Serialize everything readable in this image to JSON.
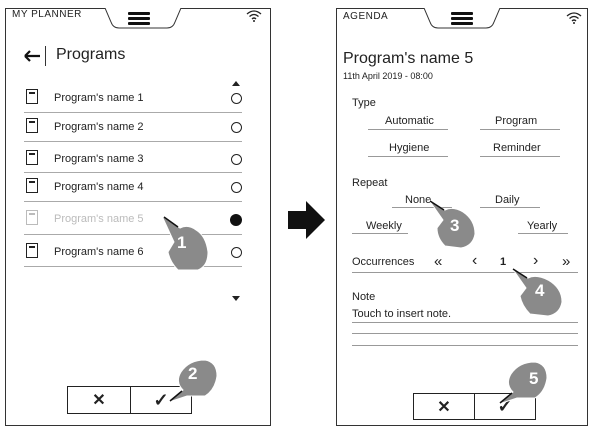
{
  "left_screen": {
    "app_title": "MY PLANNER",
    "back_icon": "arrow-left-icon",
    "page_title": "Programs",
    "items": [
      {
        "label": "Program's name 1",
        "selected": false,
        "faded": false
      },
      {
        "label": "Program's name 2",
        "selected": false,
        "faded": false
      },
      {
        "label": "Program's name 3",
        "selected": false,
        "faded": false
      },
      {
        "label": "Program's name 4",
        "selected": false,
        "faded": false
      },
      {
        "label": "Program's name 5",
        "selected": true,
        "faded": true
      },
      {
        "label": "Program's name 6",
        "selected": false,
        "faded": false
      }
    ],
    "cancel_symbol": "✕",
    "confirm_symbol": "✓"
  },
  "right_screen": {
    "app_title": "AGENDA",
    "program_title": "Program's name 5",
    "datetime": "11th April 2019 - 08:00",
    "type_label": "Type",
    "type_options": [
      "Automatic",
      "Program",
      "Hygiene",
      "Reminder"
    ],
    "repeat_label": "Repeat",
    "repeat_options": [
      "None",
      "Daily",
      "Weekly",
      "Yearly"
    ],
    "occurrences_label": "Occurrences",
    "occurrences_value": "1",
    "nav_first": "«",
    "nav_prev": "‹",
    "nav_next": "›",
    "nav_last": "»",
    "note_label": "Note",
    "note_placeholder": "Touch to insert note.",
    "cancel_symbol": "✕",
    "confirm_symbol": "✓"
  },
  "steps": [
    "1",
    "2",
    "3",
    "4",
    "5"
  ],
  "colors": {
    "text": "#222222",
    "faded": "#bbbbbb",
    "hand": "#8a8a8a",
    "arrow": "#111111"
  }
}
